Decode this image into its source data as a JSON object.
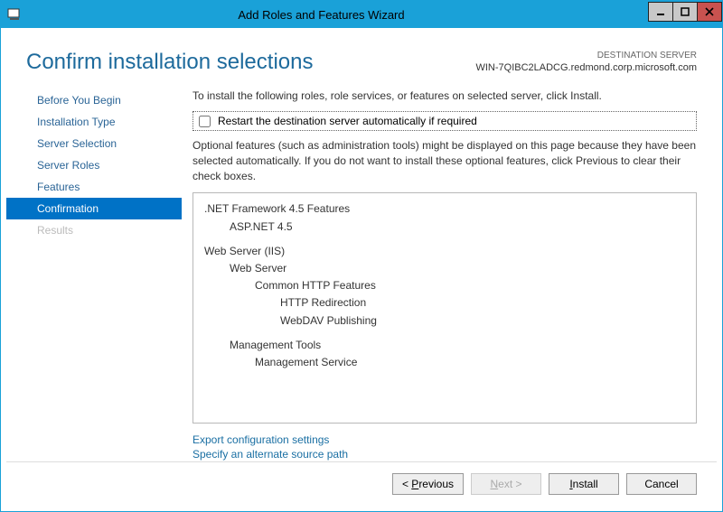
{
  "window": {
    "title": "Add Roles and Features Wizard"
  },
  "header": {
    "title": "Confirm installation selections",
    "dest_label": "DESTINATION SERVER",
    "dest_server": "WIN-7QIBC2LADCG.redmond.corp.microsoft.com"
  },
  "nav": {
    "items": [
      {
        "label": "Before You Begin",
        "state": "normal"
      },
      {
        "label": "Installation Type",
        "state": "normal"
      },
      {
        "label": "Server Selection",
        "state": "normal"
      },
      {
        "label": "Server Roles",
        "state": "normal"
      },
      {
        "label": "Features",
        "state": "normal"
      },
      {
        "label": "Confirmation",
        "state": "active"
      },
      {
        "label": "Results",
        "state": "disabled"
      }
    ]
  },
  "main": {
    "intro": "To install the following roles, role services, or features on selected server, click Install.",
    "restart_label": "Restart the destination server automatically if required",
    "restart_checked": false,
    "optional_text": "Optional features (such as administration tools) might be displayed on this page because they have been selected automatically. If you do not want to install these optional features, click Previous to clear their check boxes.",
    "items": [
      {
        "text": ".NET Framework 4.5 Features",
        "level": 0
      },
      {
        "text": "ASP.NET 4.5",
        "level": 1
      },
      {
        "spacer": true
      },
      {
        "text": "Web Server (IIS)",
        "level": 0
      },
      {
        "text": "Web Server",
        "level": 1
      },
      {
        "text": "Common HTTP Features",
        "level": 2
      },
      {
        "text": "HTTP Redirection",
        "level": 3
      },
      {
        "text": "WebDAV Publishing",
        "level": 3
      },
      {
        "spacer": true
      },
      {
        "text": "Management Tools",
        "level": 1
      },
      {
        "text": "Management Service",
        "level": 2
      }
    ],
    "link_export": "Export configuration settings",
    "link_altsource": "Specify an alternate source path"
  },
  "footer": {
    "previous": "< Previous",
    "next": "Next >",
    "install": "Install",
    "cancel": "Cancel"
  }
}
